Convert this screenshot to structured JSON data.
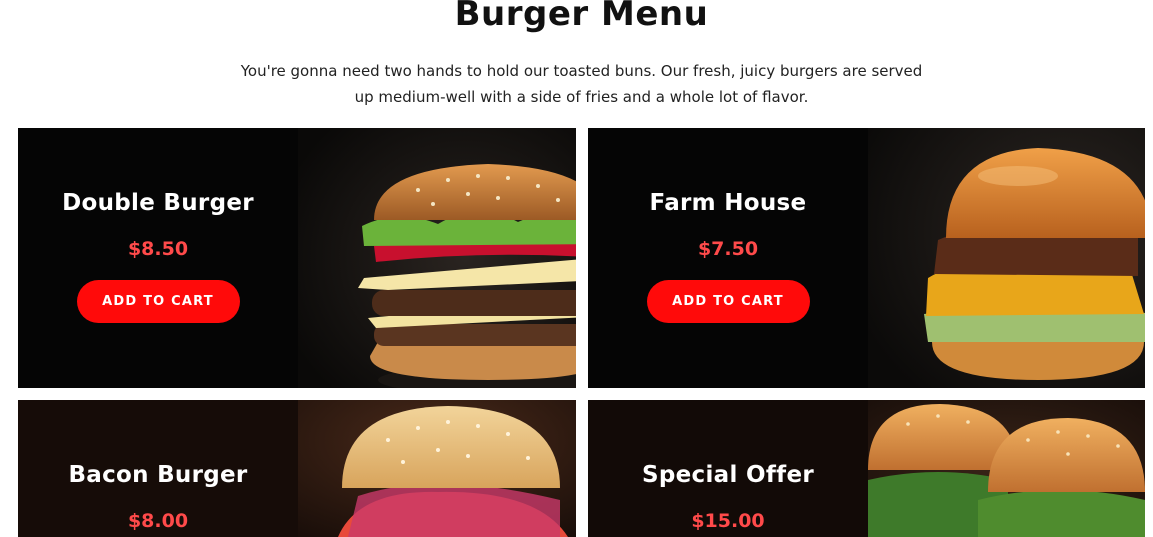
{
  "page": {
    "title": "Burger Menu",
    "intro": "You're gonna need two hands to hold our toasted buns. Our fresh, juicy burgers are served up medium-well with a side of fries and a whole lot of flavor."
  },
  "menu": {
    "items": [
      {
        "name": "Double Burger",
        "price": "$8.50",
        "button": "ADD TO CART"
      },
      {
        "name": "Farm House",
        "price": "$7.50",
        "button": "ADD TO CART"
      },
      {
        "name": "Bacon Burger",
        "price": "$8.00"
      },
      {
        "name": "Special Offer",
        "price": "$15.00"
      }
    ]
  },
  "colors": {
    "accent": "#ff0a0a",
    "price": "#ff4a4a",
    "card_background": "#050505",
    "heading": "#111111"
  }
}
